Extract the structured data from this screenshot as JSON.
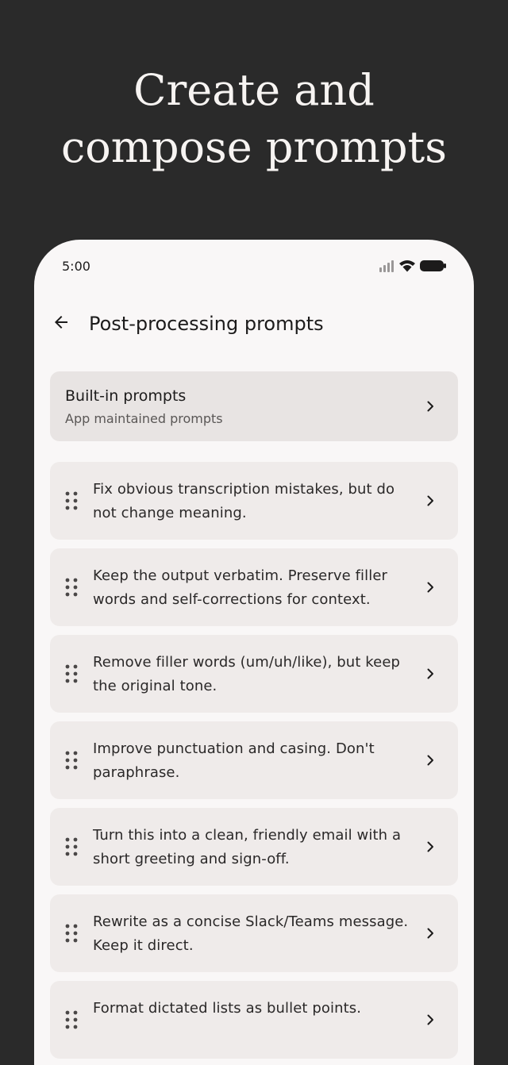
{
  "headline": {
    "line1": "Create and",
    "line2": "compose prompts"
  },
  "status_bar": {
    "time": "5:00",
    "icons": [
      "signal-icon",
      "wifi-icon",
      "battery-icon"
    ]
  },
  "app_bar": {
    "back_icon": "arrow-back-icon",
    "title": "Post-processing prompts"
  },
  "builtin": {
    "title": "Built-in prompts",
    "subtitle": "App maintained prompts"
  },
  "prompts": [
    "Fix obvious transcription mistakes, but do not change meaning.",
    "Keep the output verbatim. Preserve filler words and self-corrections for context.",
    "Remove filler words (um/uh/like), but keep the original tone.",
    "Improve punctuation and casing. Don't paraphrase.",
    "Turn this into a clean, friendly email with a short greeting and sign-off.",
    "Rewrite as a concise Slack/Teams message. Keep it direct.",
    "Format dictated lists as bullet points."
  ],
  "colors": {
    "background": "#2a2a2a",
    "surface": "#f9f7f7",
    "card": "#efebea",
    "text": "#1c1b1b"
  }
}
